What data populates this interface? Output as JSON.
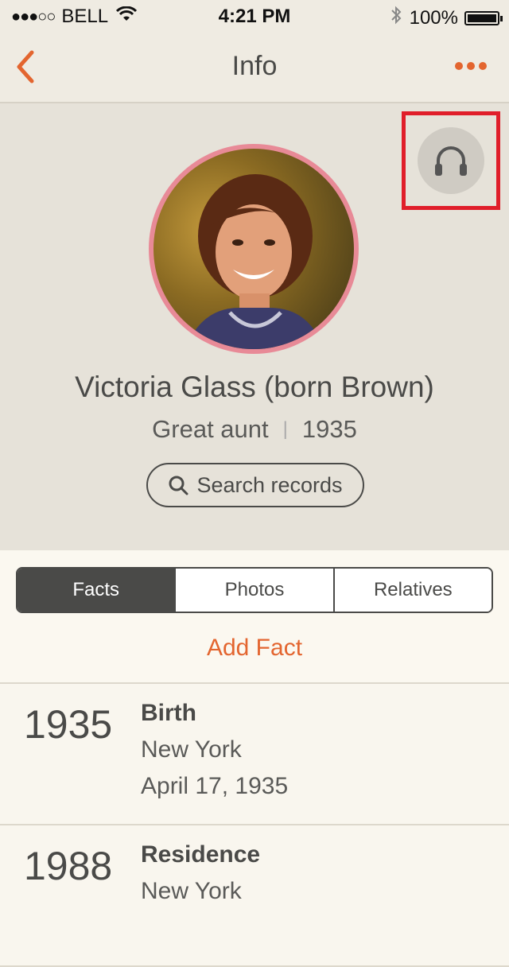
{
  "status_bar": {
    "signal": "●●●○○",
    "carrier": "BELL",
    "time": "4:21 PM",
    "battery": "100%"
  },
  "nav": {
    "title": "Info"
  },
  "profile": {
    "name": "Victoria Glass (born Brown)",
    "relation": "Great aunt",
    "birth_year": "1935",
    "search_label": "Search records"
  },
  "tabs": [
    {
      "label": "Facts",
      "active": true
    },
    {
      "label": "Photos",
      "active": false
    },
    {
      "label": "Relatives",
      "active": false
    }
  ],
  "add_fact_label": "Add Fact",
  "facts": [
    {
      "year": "1935",
      "type": "Birth",
      "place": "New York",
      "date": "April 17, 1935"
    },
    {
      "year": "1988",
      "type": "Residence",
      "place": "New York",
      "date": ""
    }
  ],
  "colors": {
    "accent": "#e3652f",
    "highlight": "#e01e2a",
    "avatar_ring": "#e88a97"
  },
  "icons": {
    "back": "chevron-left-icon",
    "more": "more-dots-icon",
    "audio": "headphones-icon",
    "search": "search-icon",
    "bluetooth": "bluetooth-icon",
    "wifi": "wifi-icon"
  }
}
